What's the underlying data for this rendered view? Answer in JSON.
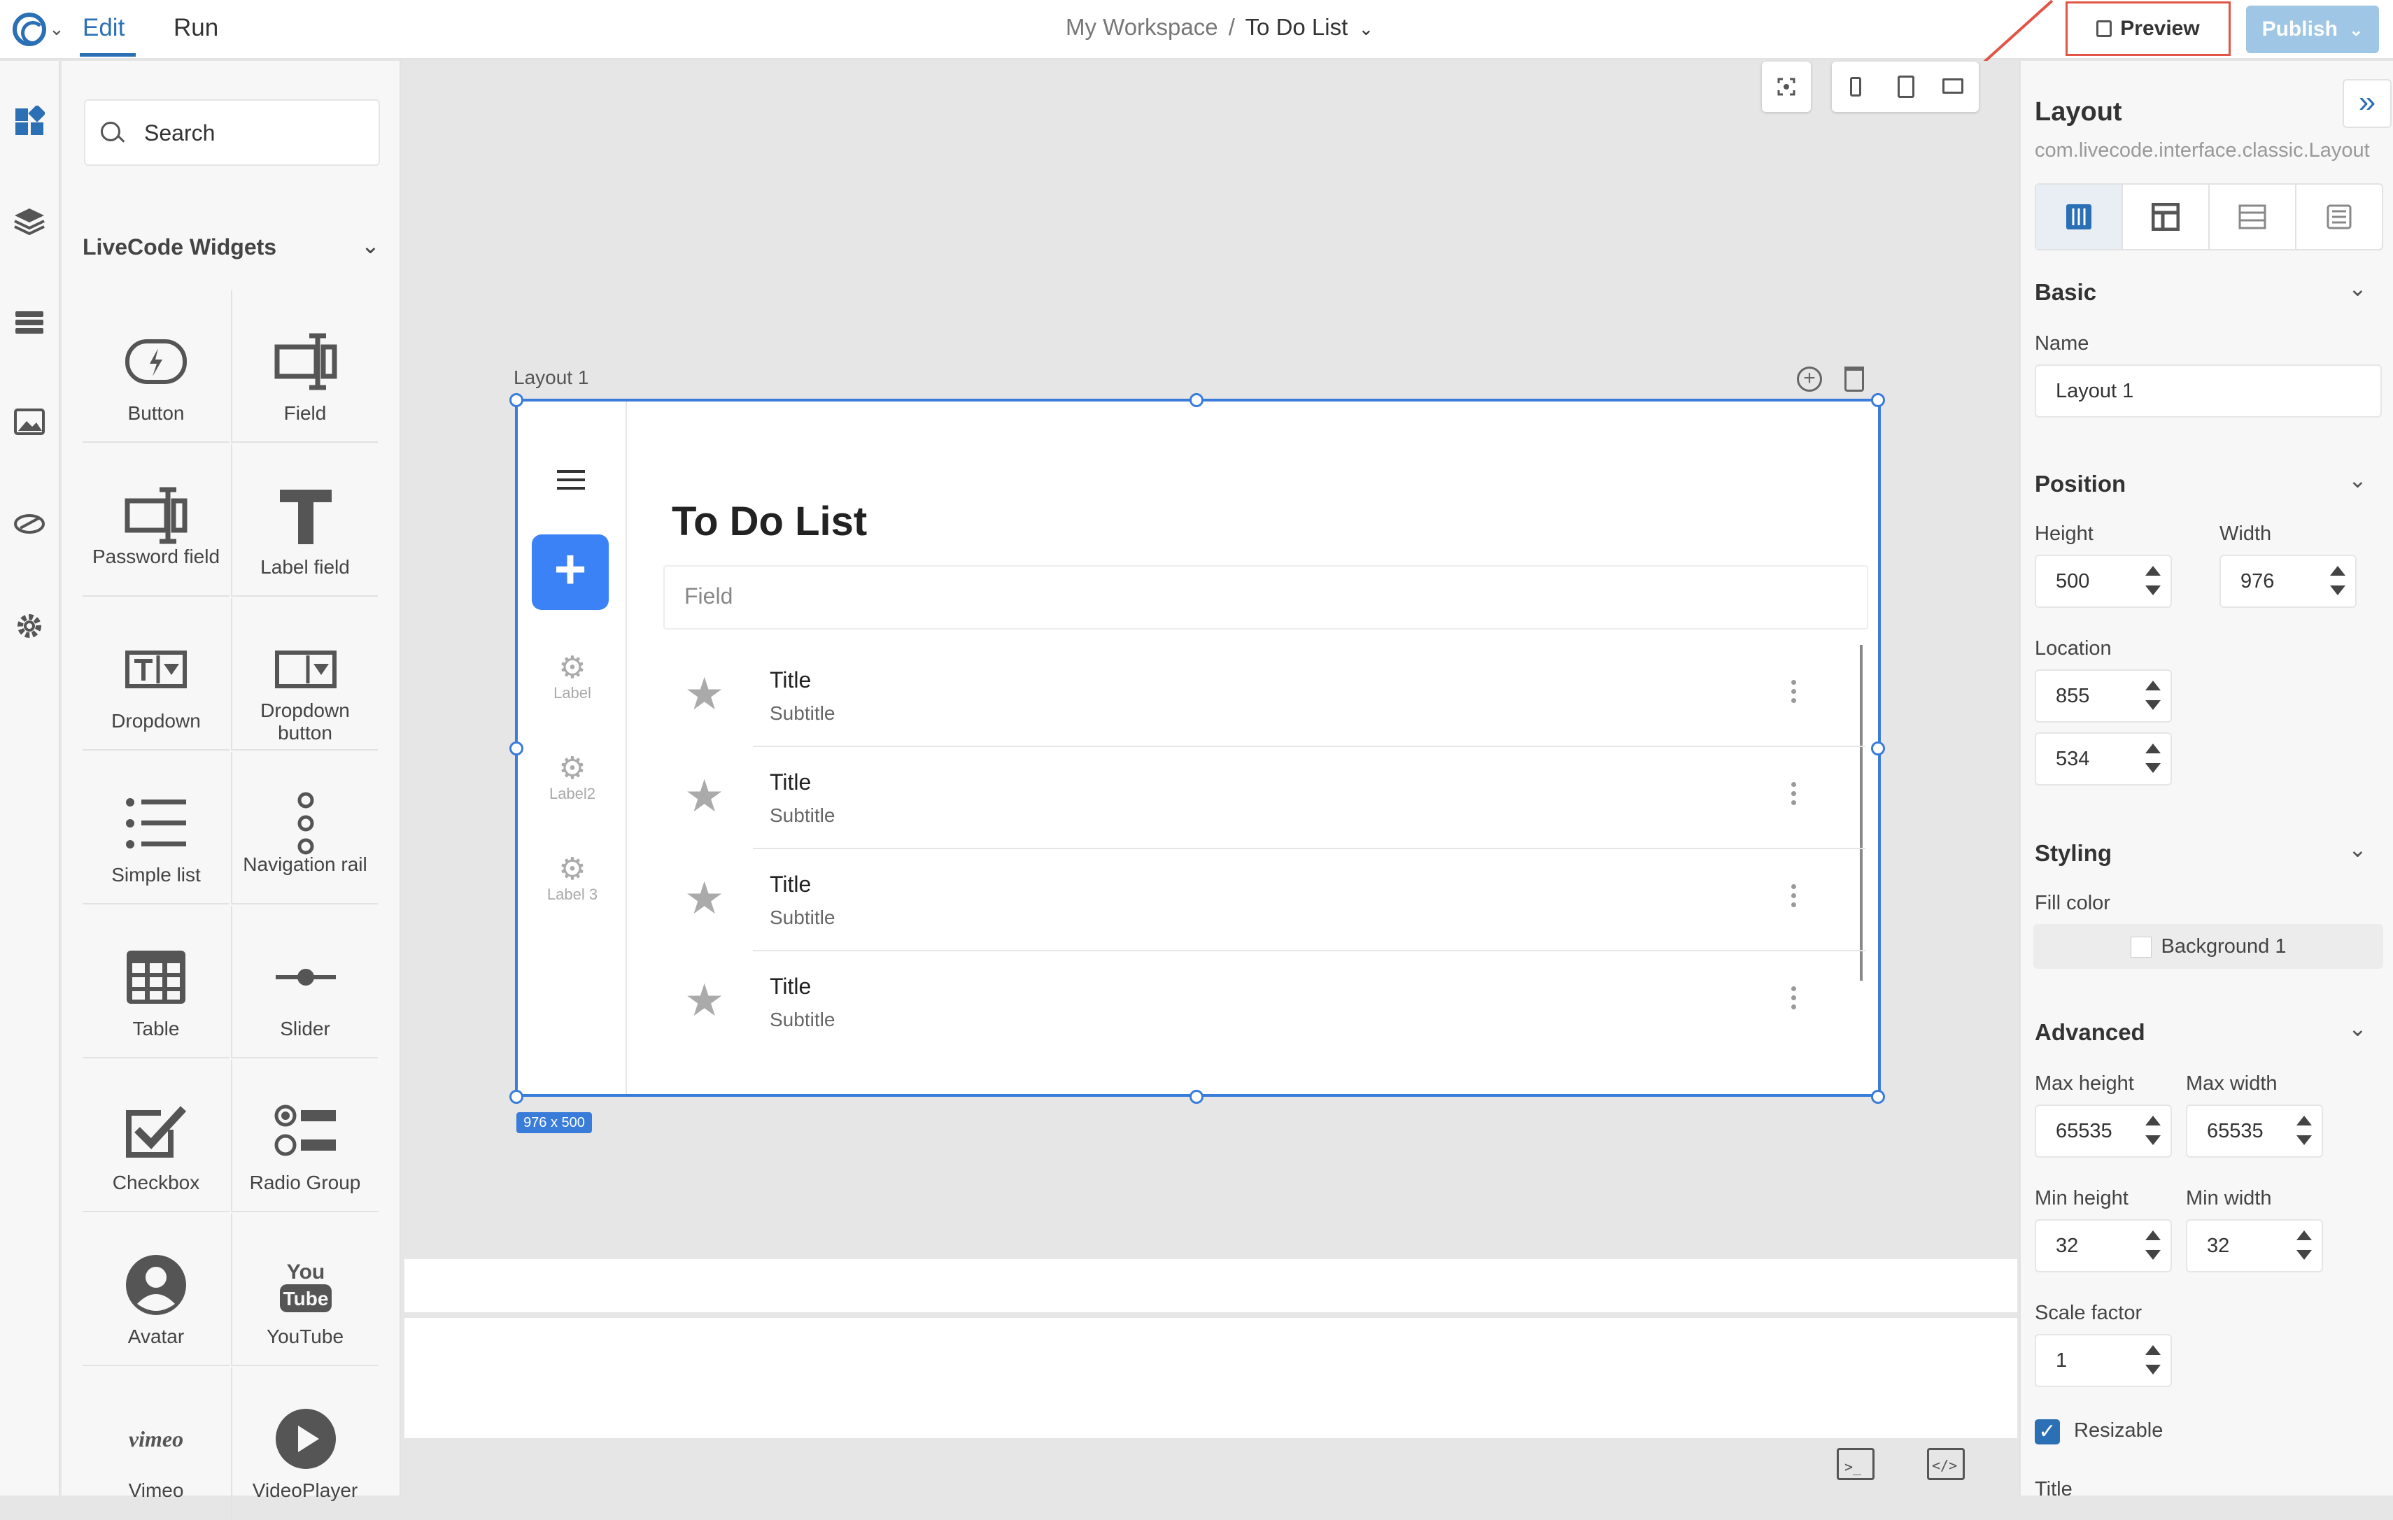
{
  "topbar": {
    "tabs": [
      {
        "label": "Edit"
      },
      {
        "label": "Run"
      }
    ],
    "breadcrumb": {
      "workspace": "My Workspace",
      "separator": "/",
      "project": "To Do List"
    },
    "preview_label": "Preview",
    "publish_label": "Publish"
  },
  "search": {
    "placeholder": "Search"
  },
  "widgets": {
    "group_title": "LiveCode Widgets",
    "items": [
      {
        "label": "Button",
        "icon": "button-icon"
      },
      {
        "label": "Field",
        "icon": "field-icon"
      },
      {
        "label": "Password field",
        "icon": "password-field-icon"
      },
      {
        "label": "Label field",
        "icon": "label-field-icon"
      },
      {
        "label": "Dropdown",
        "icon": "dropdown-icon"
      },
      {
        "label": "Dropdown button",
        "icon": "dropdown-button-icon"
      },
      {
        "label": "Simple list",
        "icon": "simple-list-icon"
      },
      {
        "label": "Navigation rail",
        "icon": "navigation-rail-icon"
      },
      {
        "label": "Table",
        "icon": "table-icon"
      },
      {
        "label": "Slider",
        "icon": "slider-icon"
      },
      {
        "label": "Checkbox",
        "icon": "checkbox-icon"
      },
      {
        "label": "Radio Group",
        "icon": "radio-group-icon"
      },
      {
        "label": "Avatar",
        "icon": "avatar-icon"
      },
      {
        "label": "YouTube",
        "icon": "youtube-icon"
      },
      {
        "label": "Vimeo",
        "icon": "vimeo-icon"
      },
      {
        "label": "VideoPlayer",
        "icon": "video-player-icon"
      }
    ]
  },
  "canvas": {
    "layout_name": "Layout 1",
    "size_badge": "976 x 500",
    "app": {
      "nav_labels": [
        "Label",
        "Label2",
        "Label 3"
      ],
      "title": "To Do List",
      "field_placeholder": "Field",
      "rows": [
        {
          "title": "Title",
          "subtitle": "Subtitle"
        },
        {
          "title": "Title",
          "subtitle": "Subtitle"
        },
        {
          "title": "Title",
          "subtitle": "Subtitle"
        },
        {
          "title": "Title",
          "subtitle": "Subtitle"
        }
      ]
    }
  },
  "panel": {
    "title": "Layout",
    "subtitle": "com.livecode.interface.classic.Layout",
    "basic": {
      "heading": "Basic",
      "name_label": "Name",
      "name_value": "Layout 1"
    },
    "position": {
      "heading": "Position",
      "height_label": "Height",
      "height_value": "500",
      "width_label": "Width",
      "width_value": "976",
      "location_label": "Location",
      "loc_x": "855",
      "loc_y": "534"
    },
    "styling": {
      "heading": "Styling",
      "fill_label": "Fill color",
      "fill_value": "Background 1"
    },
    "advanced": {
      "heading": "Advanced",
      "max_height_label": "Max height",
      "max_height": "65535",
      "max_width_label": "Max width",
      "max_width": "65535",
      "min_height_label": "Min height",
      "min_height": "32",
      "min_width_label": "Min width",
      "min_width": "32",
      "scale_label": "Scale factor",
      "scale_value": "1",
      "resizable_label": "Resizable",
      "title_label": "Title"
    }
  },
  "colors": {
    "accent": "#2b6fb5",
    "fab": "#3b82f6",
    "selection": "#3a7cd9",
    "highlight": "#e05545"
  }
}
